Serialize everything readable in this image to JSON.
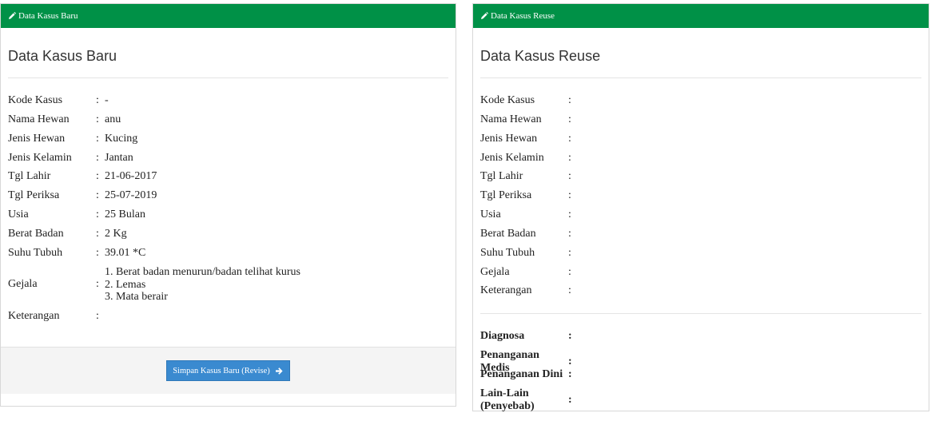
{
  "left_panel": {
    "header": "Data Kasus Baru",
    "title": "Data Kasus Baru",
    "fields": [
      {
        "label": "Kode Kasus",
        "value": "-"
      },
      {
        "label": "Nama Hewan",
        "value": "anu"
      },
      {
        "label": "Jenis Hewan",
        "value": "Kucing"
      },
      {
        "label": "Jenis Kelamin",
        "value": "Jantan"
      },
      {
        "label": "Tgl Lahir",
        "value": "21-06-2017"
      },
      {
        "label": "Tgl Periksa",
        "value": "25-07-2019"
      },
      {
        "label": "Usia",
        "value": "25 Bulan"
      },
      {
        "label": "Berat Badan",
        "value": "2 Kg"
      },
      {
        "label": "Suhu Tubuh",
        "value": "39.01 *C"
      }
    ],
    "gejala": {
      "label": "Gejala",
      "items": [
        "1. Berat badan menurun/badan telihat kurus",
        "2. Lemas",
        "3. Mata berair"
      ]
    },
    "keterangan": {
      "label": "Keterangan",
      "value": ""
    },
    "save_button": "Simpan Kasus Baru (Revise)"
  },
  "right_panel": {
    "header": "Data Kasus Reuse",
    "title": "Data Kasus Reuse",
    "fields": [
      {
        "label": "Kode Kasus",
        "value": ""
      },
      {
        "label": "Nama Hewan",
        "value": ""
      },
      {
        "label": "Jenis Hewan",
        "value": ""
      },
      {
        "label": "Jenis Kelamin",
        "value": ""
      },
      {
        "label": "Tgl Lahir",
        "value": ""
      },
      {
        "label": "Tgl Periksa",
        "value": ""
      },
      {
        "label": "Usia",
        "value": ""
      },
      {
        "label": "Berat Badan",
        "value": ""
      },
      {
        "label": "Suhu Tubuh",
        "value": ""
      },
      {
        "label": "Gejala",
        "value": ""
      },
      {
        "label": "Keterangan",
        "value": ""
      }
    ],
    "solution": [
      {
        "label": "Diagnosa",
        "value": ""
      },
      {
        "label": "Penanganan Medis",
        "value": ""
      },
      {
        "label": "Penanganan Dini",
        "value": ""
      },
      {
        "label": "Lain-Lain (Penyebab)",
        "value": ""
      }
    ]
  },
  "colon": ":",
  "colors": {
    "header_green": "#009147",
    "button_blue": "#3a8ad0",
    "footer_gray": "#f4f4f4"
  },
  "icons": {
    "header_icon": "pencil-icon",
    "button_icon": "arrow-right-icon"
  }
}
